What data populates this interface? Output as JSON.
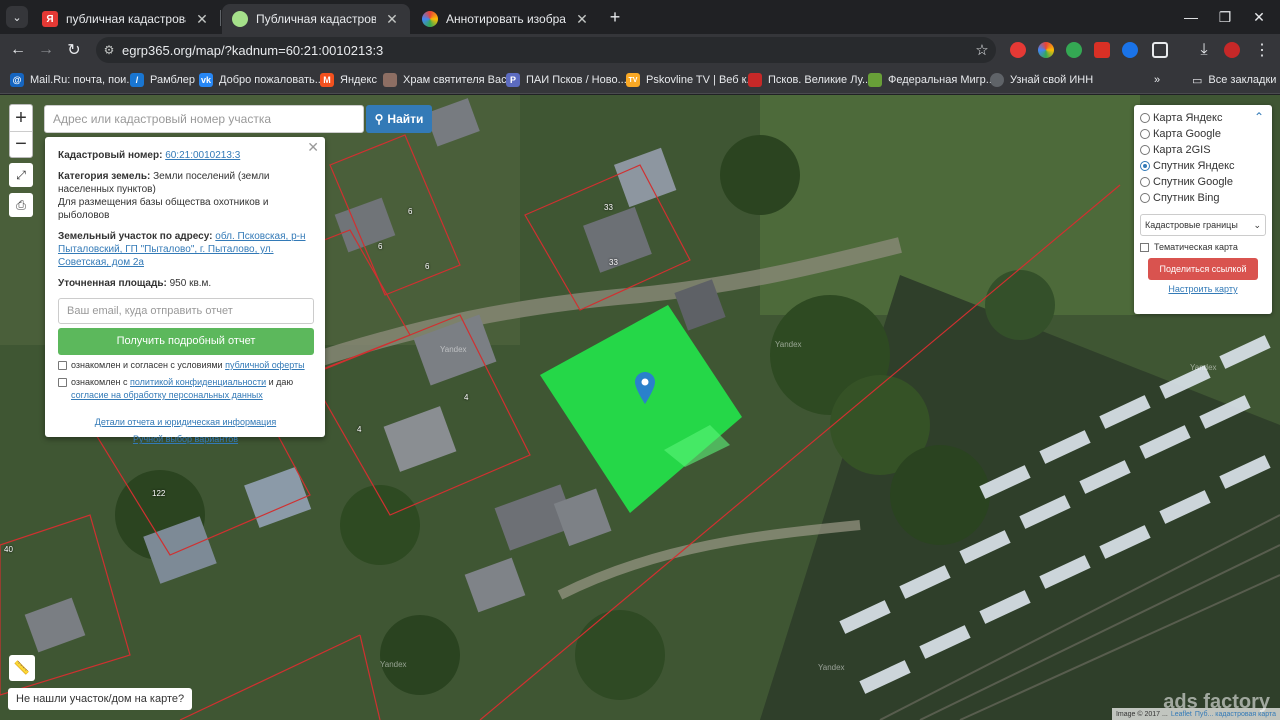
{
  "tabs": [
    {
      "title": "публичная кадастровая карта",
      "favicon": "Я",
      "favicon_color": "#e53935",
      "active": false
    },
    {
      "title": "Публичная кадастровая карта",
      "favicon": "",
      "favicon_color": "#a5e08a",
      "active": true
    },
    {
      "title": "Аннотировать изображение",
      "favicon": "",
      "favicon_color": "#4285f4",
      "active": false
    }
  ],
  "omnibox": {
    "url": "egrp365.org/map/?kadnum=60:21:0010213:3"
  },
  "bookmarks": [
    {
      "label": "Mail.Ru: почта, пои...",
      "icon": "@",
      "color": "#1565c0"
    },
    {
      "label": "Рамблер",
      "icon": "/",
      "color": "#1976d2"
    },
    {
      "label": "Добро пожаловать...",
      "icon": "vk",
      "color": "#2787f5"
    },
    {
      "label": "Яндекс",
      "icon": "M",
      "color": "#f4511e"
    },
    {
      "label": "Храм святителя Вас...",
      "icon": "",
      "color": "#8d6e63"
    },
    {
      "label": "ПАИ Псков / Ново...",
      "icon": "P",
      "color": "#5c6bc0"
    },
    {
      "label": "Pskovline TV | Веб к...",
      "icon": "TV",
      "color": "#f9a825"
    },
    {
      "label": "Псков. Великие Лу...",
      "icon": "",
      "color": "#c62828"
    },
    {
      "label": "Федеральная Мигр...",
      "icon": "",
      "color": "#689f38"
    },
    {
      "label": "Узнай свой ИНН",
      "icon": "",
      "color": "#5f6368"
    }
  ],
  "all_bookmarks": "Все закладки",
  "search": {
    "placeholder": "Адрес или кадастровый номер участка",
    "button": "Найти"
  },
  "popup": {
    "cad_label": "Кадастровый номер:",
    "cad_value": "60:21:0010213:3",
    "cat_label": "Категория земель:",
    "cat_value": "Земли поселений (земли населенных пунктов)",
    "purpose": "Для размещения базы общества охотников и рыболовов",
    "addr_label": "Земельный участок по адресу:",
    "addr_value": "обл. Псковская, р-н Пыталовский, ГП \"Пыталово\", г. Пыталово, ул. Советская, дом 2а",
    "area_label": "Уточненная площадь:",
    "area_value": "950 кв.м.",
    "email_placeholder": "Ваш email, куда отправить отчет",
    "report_button": "Получить подробный отчет",
    "agree1_pre": "ознакомлен и согласен с условиями",
    "agree1_link": "публичной оферты",
    "agree2_pre": "ознакомлен с",
    "agree2_link1": "политикой конфиденциальности",
    "agree2_mid": "и даю",
    "agree2_link2": "согласие на обработку персональных данных",
    "details_link": "Детали отчета и юридическая информация",
    "manual_link": "Ручной выбор вариантов"
  },
  "layers": {
    "options": [
      "Карта Яндекс",
      "Карта Google",
      "Карта 2GIS",
      "Спутник Яндекс",
      "Спутник Google",
      "Спутник Bing"
    ],
    "selected": "Спутник Яндекс",
    "select_value": "Кадастровые границы",
    "thematic": "Тематическая карта",
    "share": "Поделиться ссылкой",
    "setup": "Настроить карту"
  },
  "map_labels": [
    "33",
    "33",
    "6",
    "6",
    "6",
    "4",
    "4",
    "122",
    "40"
  ],
  "yandex_text": "Yandex",
  "not_found": "Не нашли участок/дом на карте?",
  "attribution": {
    "text": "Image © 2017 ...",
    "leaflet": "Leaflet",
    "extra": "Пуб... кадастровая карта"
  },
  "watermark": "ads factory",
  "colors": {
    "parcel": "#22e64a",
    "marker": "#2a81cb",
    "cad_border": "#d03030"
  }
}
